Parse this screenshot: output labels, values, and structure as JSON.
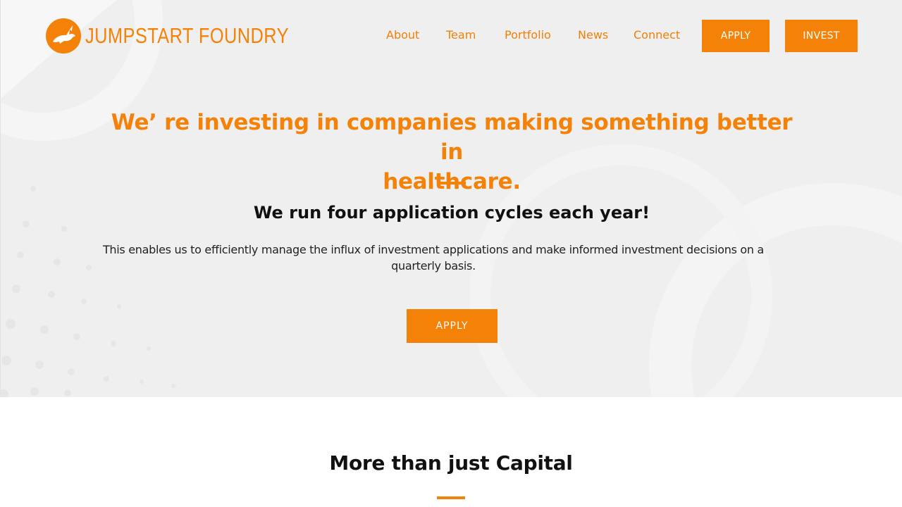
{
  "brand": {
    "name": "JUMPSTART FOUNDRY",
    "color": "#f58208",
    "logo_icon": "rabbit-icon"
  },
  "nav": {
    "links": [
      "About",
      "Team",
      "Portfolio",
      "News",
      "Connect"
    ],
    "apply_label": "APPLY",
    "invest_label": "INVEST"
  },
  "hero": {
    "headline_line1": "We’ re investing in companies making something better in",
    "headline_line2": "healthcare.",
    "subheading": "We run four application cycles each year!",
    "paragraph_line1": "This enables us to efficiently manage the influx of investment applications and make informed investment decisions on a",
    "paragraph_line2": "quarterly basis.",
    "cta_label": "APPLY"
  },
  "section": {
    "title": "More than just Capital"
  }
}
